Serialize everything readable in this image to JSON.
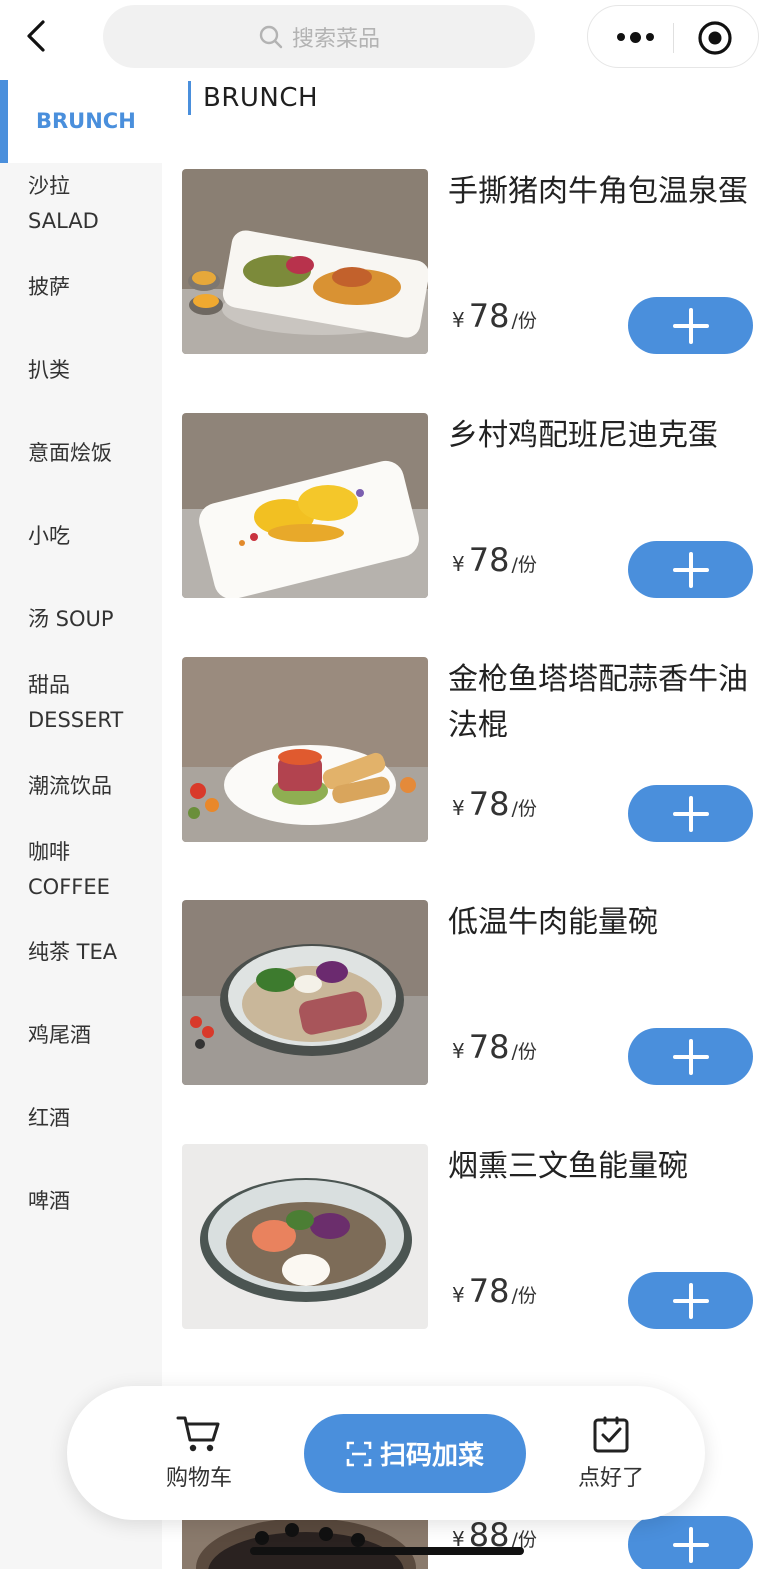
{
  "header": {
    "search_placeholder": "搜索菜品",
    "back_icon": "chevron-left-icon",
    "more_icon": "more-dots-icon",
    "target_icon": "target-circle-icon"
  },
  "sidebar": {
    "items": [
      {
        "label": "BRUNCH",
        "active": true
      },
      {
        "label": "沙拉\nSALAD"
      },
      {
        "label": "披萨"
      },
      {
        "label": "扒类"
      },
      {
        "label": "意面烩饭"
      },
      {
        "label": "小吃"
      },
      {
        "label": "汤 SOUP"
      },
      {
        "label": "甜品\nDESSERT"
      },
      {
        "label": "潮流饮品"
      },
      {
        "label": "咖啡\nCOFFEE"
      },
      {
        "label": "纯茶 TEA"
      },
      {
        "label": "鸡尾酒"
      },
      {
        "label": "红酒"
      },
      {
        "label": "啤酒"
      }
    ]
  },
  "section": {
    "title": "BRUNCH"
  },
  "products": [
    {
      "name": "手撕猪肉牛角包温泉蛋",
      "currency": "¥",
      "price": "78",
      "unit": "/份"
    },
    {
      "name": "乡村鸡配班尼迪克蛋",
      "currency": "¥",
      "price": "78",
      "unit": "/份"
    },
    {
      "name": "金枪鱼塔塔配蒜香牛油法棍",
      "currency": "¥",
      "price": "78",
      "unit": "/份"
    },
    {
      "name": "低温牛肉能量碗",
      "currency": "¥",
      "price": "78",
      "unit": "/份"
    },
    {
      "name": "烟熏三文鱼能量碗",
      "currency": "¥",
      "price": "78",
      "unit": "/份"
    },
    {
      "name": "",
      "currency": "¥",
      "price": "88",
      "unit": "/份"
    }
  ],
  "bottom_bar": {
    "cart_label": "购物车",
    "scan_label": "扫码加菜",
    "done_label": "点好了"
  },
  "colors": {
    "accent": "#4a8fdc",
    "sidebar_bg": "#f6f6f6"
  }
}
